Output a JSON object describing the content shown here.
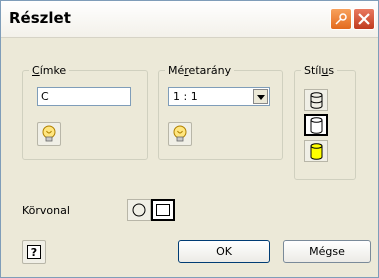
{
  "window": {
    "title": "Részlet",
    "pin_icon": "pin-icon",
    "close_icon": "close-icon"
  },
  "cimke": {
    "legend_accel": "C",
    "legend_rest": "ímke",
    "text_value": "C",
    "icon": "lightbulb-icon"
  },
  "meretarany": {
    "legend_pre": "Mé",
    "legend_accel": "r",
    "legend_post": "etarány",
    "selected": "1 : 1",
    "icon": "lightbulb-icon"
  },
  "stilus": {
    "legend_pre": "Stíl",
    "legend_accel": "u",
    "legend_post": "s",
    "options": [
      {
        "icon": "cylinder-outline-icon",
        "pressed": false
      },
      {
        "icon": "cylinder-outline-icon",
        "pressed": true
      },
      {
        "icon": "cylinder-shaded-icon",
        "pressed": false
      }
    ]
  },
  "korvonal": {
    "label": "Körvonal",
    "options": [
      {
        "icon": "circle-outline-icon",
        "pressed": false
      },
      {
        "icon": "square-outline-icon",
        "pressed": true
      }
    ]
  },
  "buttons": {
    "help_icon": "help-icon",
    "ok": "OK",
    "cancel": "Mégse"
  },
  "colors": {
    "window_bg": "#ece9d8",
    "close_button": "#c03b1f",
    "pin_button": "#e36a1e",
    "shaded_fill": "#ffff00"
  }
}
